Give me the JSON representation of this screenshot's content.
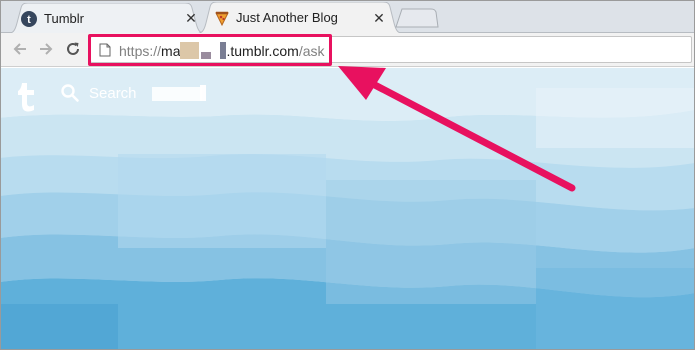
{
  "browser": {
    "tabs": [
      {
        "title": "Tumblr",
        "icon": "tumblr-favicon-icon",
        "active": false
      },
      {
        "title": "Just Another Blog",
        "icon": "pizza-favicon-icon",
        "active": true
      }
    ],
    "close_glyph": "✕",
    "address_bar": {
      "scheme": "https://",
      "host_start": "ma",
      "host_end": ".tumblr.com",
      "path": "/ask"
    }
  },
  "page": {
    "search_label": "Search"
  },
  "colors": {
    "highlight": "#e8115f",
    "sky_light": "#d4ebf5",
    "sky_mid": "#9ccde6",
    "sky_deep": "#46a2d0"
  }
}
